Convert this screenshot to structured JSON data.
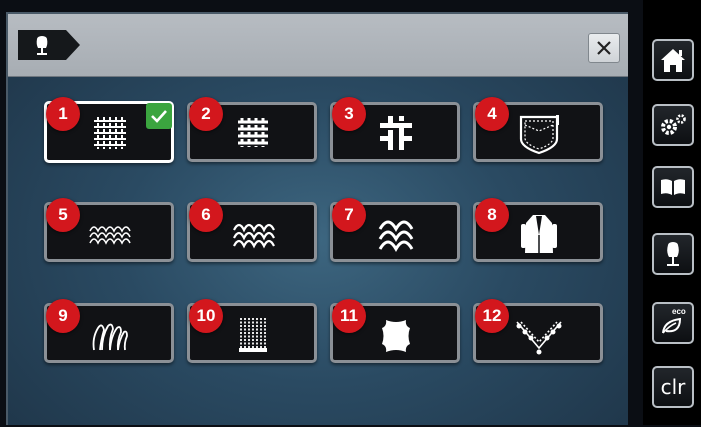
{
  "header": {
    "mode_icon": "sewing-dress-form-icon",
    "close_icon": "close-icon"
  },
  "fabric_tiles": [
    {
      "number": "1",
      "icon": "light-woven-fabric-icon",
      "selected": true
    },
    {
      "number": "2",
      "icon": "medium-woven-fabric-icon",
      "selected": false
    },
    {
      "number": "3",
      "icon": "heavy-woven-fabric-icon",
      "selected": false
    },
    {
      "number": "4",
      "icon": "denim-pocket-icon",
      "selected": false
    },
    {
      "number": "5",
      "icon": "light-knit-fabric-icon",
      "selected": false
    },
    {
      "number": "6",
      "icon": "medium-knit-fabric-icon",
      "selected": false
    },
    {
      "number": "7",
      "icon": "heavy-knit-fabric-icon",
      "selected": false
    },
    {
      "number": "8",
      "icon": "coat-icon",
      "selected": false
    },
    {
      "number": "9",
      "icon": "fur-pile-icon",
      "selected": false
    },
    {
      "number": "10",
      "icon": "terry-cloth-icon",
      "selected": false
    },
    {
      "number": "11",
      "icon": "leather-hide-icon",
      "selected": false
    },
    {
      "number": "12",
      "icon": "lace-icon",
      "selected": false
    }
  ],
  "sidebar": {
    "items": [
      {
        "icon": "home-icon"
      },
      {
        "icon": "settings-gears-icon"
      },
      {
        "icon": "guide-book-icon"
      },
      {
        "icon": "dress-form-icon"
      },
      {
        "icon": "eco-leaf-icon",
        "label": "eco"
      },
      {
        "icon": "clear-icon",
        "label": "clr"
      }
    ]
  },
  "colors": {
    "badge": "#d3171d",
    "check": "#3ba53f",
    "background": "#2a4a62",
    "header": "#b0b5bb"
  }
}
